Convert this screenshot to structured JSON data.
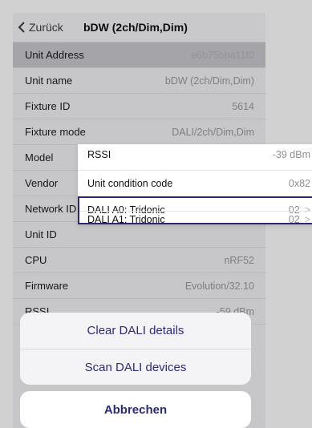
{
  "nav": {
    "back_label": "Zurück",
    "title": "bDW (2ch/Dim,Dim)"
  },
  "rows": [
    {
      "label": "Unit Address",
      "value": "e6b75bba11f0"
    },
    {
      "label": "Unit name",
      "value": "bDW (2ch/Dim,Dim)"
    },
    {
      "label": "Fixture ID",
      "value": "5614"
    },
    {
      "label": "Fixture mode",
      "value": "DALI/2ch/Dim,Dim"
    },
    {
      "label": "Model",
      "value": ""
    },
    {
      "label": "Vendor",
      "value": ""
    },
    {
      "label": "Network ID",
      "value": ""
    },
    {
      "label": "Unit ID",
      "value": ""
    },
    {
      "label": "CPU",
      "value": "nRF52"
    },
    {
      "label": "Firmware",
      "value": "Evolution/32.10"
    },
    {
      "label": "RSSI",
      "value": "-59 dBm"
    }
  ],
  "popover": {
    "items": [
      {
        "label": "RSSI",
        "value": "-39 dBm"
      },
      {
        "label": "Unit condition code",
        "value": "0x82"
      },
      {
        "label": "DALI A0: Tridonic",
        "value": "02",
        "chevron": ">"
      },
      {
        "label": "DALI A1: Tridonic",
        "value": "02",
        "chevron": ">"
      }
    ]
  },
  "actions": {
    "clear_label": "Clear DALI details",
    "scan_label": "Scan DALI devices",
    "cancel_label": "Abbrechen"
  },
  "colors": {
    "accent": "#2e2a78",
    "highlight_border": "#2d2670"
  }
}
